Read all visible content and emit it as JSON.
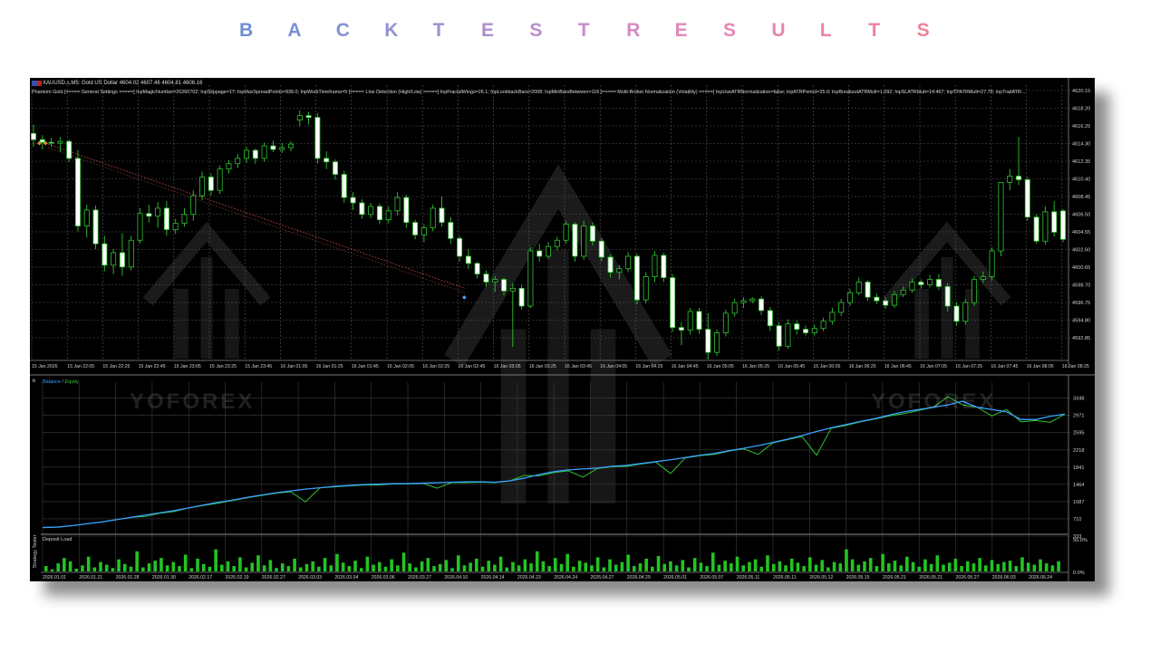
{
  "heading": {
    "letters": [
      "B",
      "A",
      "C",
      "K",
      "T",
      "E",
      "S",
      "T",
      "R",
      "E",
      "S",
      "U",
      "L",
      "T",
      "S"
    ],
    "colors": [
      "#6d8fd4",
      "#7a8fd6",
      "#8390d5",
      "#9191d4",
      "#9e8fd0",
      "#ad8ece",
      "#bb8ccb",
      "#c98bc7",
      "#d58ac2",
      "#dd89bc",
      "#e487b5",
      "#e886ae",
      "#eb85a7",
      "#ec84a0",
      "#ed8399"
    ]
  },
  "terminal": {
    "symbol_line": "XAUUSD.s,M5:  Gold US Dollar  4604.02 4607.46 4604.81 4606.16",
    "params_line": "Phantom Gold [===== General Settings =====] InpMagicNumber=20260702; InpSlippage=17; InpMaxSpreadPoints=936.0; InpWorkTimeframe=5 [===== Line Detection (High/Low) =====] InpFractalWings=26.1; InpLookbackBars=2008; InpMinBarsBetween=116 [===== Multi-Broker Normalization (Volatility) =====] InpUseATRNormalization=false; InpATRPeriod=25.0; InpBreakoutATRMult=1.092; InpSLATRMult=14.467; InpTPATRMult=27.78; InpTrailATR...",
    "price_labels": [
      "4620.15",
      "4618.20",
      "4616.25",
      "4614.30",
      "4612.35",
      "4610.40",
      "4608.45",
      "4606.50",
      "4604.55",
      "4602.60",
      "4600.65",
      "4598.70",
      "4596.75",
      "4594.80",
      "4592.85"
    ],
    "time_labels": [
      "15 Jan 2026",
      "15 Jan 22:05",
      "15 Jan 22:25",
      "15 Jan 22:45",
      "15 Jan 23:05",
      "15 Jan 23:25",
      "15 Jan 23:45",
      "16 Jan 01:05",
      "16 Jan 01:25",
      "16 Jan 01:45",
      "16 Jan 02:05",
      "16 Jan 02:25",
      "16 Jan 02:45",
      "16 Jan 03:05",
      "16 Jan 03:25",
      "16 Jan 03:45",
      "16 Jan 04:05",
      "16 Jan 04:25",
      "16 Jan 04:45",
      "16 Jan 05:05",
      "16 Jan 05:25",
      "16 Jan 05:45",
      "16 Jan 06:05",
      "16 Jan 06:25",
      "16 Jan 06:45",
      "16 Jan 07:05",
      "16 Jan 07:25",
      "16 Jan 07:45",
      "16 Jan 08:05",
      "16 Jan 08:25"
    ],
    "price_range": [
      4591.5,
      4621.0
    ],
    "candles": [
      [
        4617.0,
        4618.0,
        4615.5,
        4616.3
      ],
      [
        4616.3,
        4616.8,
        4615.2,
        4616.0
      ],
      [
        4616.0,
        4616.5,
        4615.5,
        4615.9
      ],
      [
        4615.9,
        4616.6,
        4614.9,
        4616.1
      ],
      [
        4616.1,
        4616.3,
        4613.8,
        4614.2
      ],
      [
        4614.2,
        4615.1,
        4606.0,
        4606.6
      ],
      [
        4606.6,
        4609.0,
        4605.3,
        4608.4
      ],
      [
        4608.4,
        4608.9,
        4604.0,
        4604.6
      ],
      [
        4604.6,
        4605.5,
        4601.5,
        4602.2
      ],
      [
        4602.2,
        4604.0,
        4601.2,
        4603.6
      ],
      [
        4603.6,
        4605.8,
        4601.0,
        4602.0
      ],
      [
        4602.0,
        4605.5,
        4601.6,
        4605.0
      ],
      [
        4605.0,
        4608.6,
        4604.6,
        4608.0
      ],
      [
        4608.0,
        4609.0,
        4607.0,
        4607.7
      ],
      [
        4607.7,
        4609.3,
        4606.4,
        4608.6
      ],
      [
        4608.6,
        4609.4,
        4605.5,
        4606.2
      ],
      [
        4606.2,
        4607.4,
        4605.7,
        4606.9
      ],
      [
        4606.9,
        4608.6,
        4606.5,
        4607.9
      ],
      [
        4607.9,
        4610.6,
        4607.2,
        4610.0
      ],
      [
        4610.0,
        4612.7,
        4609.5,
        4612.1
      ],
      [
        4612.1,
        4612.5,
        4610.0,
        4610.6
      ],
      [
        4610.6,
        4613.4,
        4610.2,
        4613.0
      ],
      [
        4613.0,
        4614.0,
        4612.5,
        4613.6
      ],
      [
        4613.6,
        4614.7,
        4613.1,
        4614.2
      ],
      [
        4614.2,
        4615.5,
        4613.7,
        4615.1
      ],
      [
        4615.1,
        4615.3,
        4613.6,
        4614.2
      ],
      [
        4614.2,
        4616.0,
        4613.8,
        4615.6
      ],
      [
        4615.6,
        4616.2,
        4614.9,
        4615.2
      ],
      [
        4615.2,
        4615.9,
        4614.8,
        4615.4
      ],
      [
        4615.4,
        4616.1,
        4615.0,
        4615.8
      ],
      [
        4618.5,
        4619.6,
        4617.8,
        4619.0
      ],
      [
        4619.0,
        4619.4,
        4618.0,
        4618.8
      ],
      [
        4618.8,
        4619.3,
        4613.6,
        4614.2
      ],
      [
        4614.2,
        4615.0,
        4613.0,
        4613.8
      ],
      [
        4613.8,
        4614.1,
        4611.8,
        4612.4
      ],
      [
        4612.4,
        4612.8,
        4609.2,
        4609.8
      ],
      [
        4609.8,
        4610.4,
        4608.4,
        4609.2
      ],
      [
        4609.2,
        4609.6,
        4607.4,
        4607.9
      ],
      [
        4607.9,
        4609.2,
        4607.5,
        4608.8
      ],
      [
        4608.8,
        4609.1,
        4606.8,
        4607.3
      ],
      [
        4607.3,
        4608.8,
        4606.9,
        4608.3
      ],
      [
        4608.3,
        4610.4,
        4607.8,
        4609.8
      ],
      [
        4609.8,
        4610.1,
        4606.4,
        4607.0
      ],
      [
        4607.0,
        4607.3,
        4605.1,
        4605.6
      ],
      [
        4605.6,
        4606.8,
        4604.8,
        4606.4
      ],
      [
        4606.4,
        4609.0,
        4606.0,
        4608.6
      ],
      [
        4608.6,
        4609.9,
        4606.5,
        4607.0
      ],
      [
        4607.0,
        4607.6,
        4604.6,
        4605.2
      ],
      [
        4605.2,
        4605.5,
        4602.6,
        4603.2
      ],
      [
        4603.2,
        4604.0,
        4601.8,
        4602.4
      ],
      [
        4602.4,
        4602.6,
        4600.7,
        4601.2
      ],
      [
        4601.2,
        4601.6,
        4599.8,
        4600.3
      ],
      [
        4600.3,
        4601.0,
        4599.2,
        4600.6
      ],
      [
        4600.6,
        4600.8,
        4598.8,
        4599.3
      ],
      [
        4599.3,
        4600.2,
        4593.0,
        4599.6
      ],
      [
        4599.6,
        4600.0,
        4597.2,
        4597.6
      ],
      [
        4597.6,
        4604.2,
        4597.4,
        4603.8
      ],
      [
        4603.8,
        4604.6,
        4602.6,
        4603.2
      ],
      [
        4603.2,
        4604.8,
        4602.9,
        4604.3
      ],
      [
        4604.3,
        4605.4,
        4603.9,
        4605.0
      ],
      [
        4605.0,
        4607.2,
        4604.6,
        4606.8
      ],
      [
        4606.8,
        4607.0,
        4602.6,
        4603.2
      ],
      [
        4603.2,
        4607.2,
        4602.8,
        4606.6
      ],
      [
        4606.6,
        4607.0,
        4604.4,
        4604.9
      ],
      [
        4604.9,
        4605.2,
        4602.6,
        4603.1
      ],
      [
        4603.1,
        4603.4,
        4600.8,
        4601.4
      ],
      [
        4601.4,
        4602.2,
        4600.6,
        4601.8
      ],
      [
        4601.8,
        4603.7,
        4601.4,
        4603.2
      ],
      [
        4603.2,
        4603.5,
        4597.8,
        4598.3
      ],
      [
        4598.3,
        4601.4,
        4597.9,
        4600.9
      ],
      [
        4600.9,
        4603.8,
        4600.3,
        4603.3
      ],
      [
        4603.3,
        4603.6,
        4600.3,
        4600.8
      ],
      [
        4600.8,
        4601.2,
        4594.7,
        4595.2
      ],
      [
        4595.2,
        4595.8,
        4593.2,
        4594.9
      ],
      [
        4594.9,
        4597.4,
        4594.4,
        4597.0
      ],
      [
        4597.0,
        4597.4,
        4594.5,
        4595.0
      ],
      [
        4595.0,
        4596.8,
        4591.6,
        4592.4
      ],
      [
        4592.4,
        4595.0,
        4592.0,
        4594.6
      ],
      [
        4594.6,
        4597.2,
        4594.2,
        4596.8
      ],
      [
        4596.8,
        4598.4,
        4596.4,
        4598.0
      ],
      [
        4598.0,
        4598.6,
        4597.4,
        4598.2
      ],
      [
        4598.2,
        4598.6,
        4597.9,
        4598.4
      ],
      [
        4598.4,
        4598.7,
        4596.6,
        4597.1
      ],
      [
        4597.1,
        4597.5,
        4594.8,
        4595.4
      ],
      [
        4595.4,
        4595.8,
        4592.6,
        4593.1
      ],
      [
        4593.1,
        4596.1,
        4592.8,
        4595.6
      ],
      [
        4595.6,
        4596.0,
        4594.4,
        4595.0
      ],
      [
        4595.0,
        4595.4,
        4594.3,
        4594.6
      ],
      [
        4594.6,
        4595.5,
        4594.3,
        4595.1
      ],
      [
        4595.1,
        4596.3,
        4594.8,
        4595.9
      ],
      [
        4595.9,
        4597.4,
        4595.5,
        4596.9
      ],
      [
        4596.9,
        4598.4,
        4596.5,
        4598.0
      ],
      [
        4598.0,
        4599.5,
        4597.6,
        4599.1
      ],
      [
        4599.1,
        4600.8,
        4598.8,
        4600.3
      ],
      [
        4600.3,
        4600.5,
        4598.2,
        4598.6
      ],
      [
        4598.6,
        4599.0,
        4597.8,
        4598.2
      ],
      [
        4598.2,
        4598.6,
        4597.3,
        4597.7
      ],
      [
        4597.7,
        4599.3,
        4597.4,
        4598.9
      ],
      [
        4598.9,
        4599.8,
        4598.6,
        4599.4
      ],
      [
        4599.4,
        4600.7,
        4599.1,
        4600.3
      ],
      [
        4600.3,
        4600.6,
        4599.6,
        4600.0
      ],
      [
        4600.0,
        4601.1,
        4599.7,
        4600.6
      ],
      [
        4600.6,
        4601.2,
        4599.4,
        4599.8
      ],
      [
        4599.8,
        4600.2,
        4597.0,
        4597.6
      ],
      [
        4597.6,
        4598.0,
        4595.4,
        4595.9
      ],
      [
        4595.9,
        4598.4,
        4595.5,
        4598.0
      ],
      [
        4598.0,
        4601.0,
        4597.6,
        4600.6
      ],
      [
        4600.6,
        4601.5,
        4600.2,
        4600.9
      ],
      [
        4600.9,
        4604.2,
        4600.5,
        4603.8
      ],
      [
        4603.8,
        4610.8,
        4603.2,
        4611.5
      ],
      [
        4611.5,
        4613.0,
        4610.6,
        4612.2
      ],
      [
        4612.2,
        4616.6,
        4611.2,
        4611.8
      ],
      [
        4611.8,
        4612.1,
        4607.2,
        4607.6
      ],
      [
        4607.6,
        4607.9,
        4604.6,
        4604.9
      ],
      [
        4604.9,
        4608.8,
        4604.5,
        4608.2
      ],
      [
        4608.2,
        4609.4,
        4605.4,
        4605.9
      ],
      [
        4608.3,
        4608.5,
        4604.8,
        4605.1
      ]
    ],
    "trendline_note": "",
    "equity": {
      "title_balance": "Balance",
      "title_equity": "Equity",
      "y_labels": [
        "3348",
        "2971",
        "2595",
        "2218",
        "1841",
        "1464",
        "1087",
        "710",
        "333"
      ],
      "x_labels": [
        "2026.01.01",
        "2026.01.21",
        "2026.01.28",
        "2026.01.30",
        "2026.02.17",
        "2026.02.19",
        "2026.02.27",
        "2026.03.03",
        "2026.03.04",
        "2026.03.06",
        "2026.03.27",
        "2026.04.10",
        "2026.04.14",
        "2026.04.23",
        "2026.04.24",
        "2026.04.27",
        "2026.04.29",
        "2026.05.01",
        "2026.05.07",
        "2026.05.11",
        "2026.05.11",
        "2026.05.12",
        "2026.05.15",
        "2026.05.21",
        "2026.05.21",
        "2026.05.27",
        "2026.06.03",
        "2026.06.24"
      ],
      "y_range": [
        333,
        3500
      ],
      "balance": [
        520,
        530,
        560,
        600,
        640,
        690,
        740,
        790,
        840,
        890,
        950,
        1010,
        1070,
        1120,
        1180,
        1230,
        1280,
        1320,
        1360,
        1390,
        1420,
        1440,
        1460,
        1470,
        1480,
        1480,
        1490,
        1500,
        1510,
        1520,
        1520,
        1510,
        1540,
        1600,
        1680,
        1740,
        1780,
        1800,
        1820,
        1860,
        1880,
        1920,
        1960,
        2000,
        2050,
        2100,
        2140,
        2200,
        2250,
        2310,
        2380,
        2450,
        2530,
        2620,
        2700,
        2770,
        2840,
        2900,
        2980,
        3050,
        3100,
        3150,
        3200,
        3280,
        3150,
        3100,
        3050,
        2880,
        2880,
        2950,
        3000
      ],
      "equity": [
        520,
        530,
        560,
        600,
        640,
        690,
        740,
        760,
        830,
        870,
        950,
        1000,
        1050,
        1110,
        1170,
        1220,
        1270,
        1300,
        1080,
        1390,
        1410,
        1430,
        1450,
        1450,
        1470,
        1470,
        1490,
        1380,
        1500,
        1500,
        1510,
        1500,
        1540,
        1660,
        1650,
        1720,
        1760,
        1620,
        1810,
        1850,
        1860,
        1910,
        1950,
        1700,
        2040,
        2090,
        2120,
        2190,
        2240,
        2120,
        2370,
        2440,
        2510,
        2100,
        2690,
        2750,
        2830,
        2890,
        2960,
        3010,
        3080,
        3150,
        3380,
        3200,
        3150,
        2960,
        3100,
        2830,
        2860,
        2820,
        3000
      ]
    },
    "deposit": {
      "title": "Deposit Load",
      "y_labels": [
        "50.0%",
        "0.0%"
      ],
      "bars": [
        8,
        3,
        12,
        20,
        15,
        4,
        9,
        22,
        6,
        14,
        10,
        5,
        18,
        11,
        7,
        30,
        6,
        12,
        16,
        20,
        9,
        14,
        8,
        25,
        5,
        19,
        11,
        7,
        33,
        10,
        15,
        8,
        21,
        6,
        13,
        24,
        9,
        17,
        5,
        12,
        8,
        19,
        6,
        11,
        15,
        7,
        20,
        9,
        26,
        13,
        8,
        16,
        5,
        22,
        10,
        14,
        7,
        18,
        9,
        28,
        12,
        6,
        15,
        20,
        8,
        11,
        17,
        5,
        24,
        9,
        13,
        19,
        7,
        16,
        10,
        22,
        6,
        14,
        9,
        18,
        12,
        30,
        15,
        8,
        20,
        11,
        26,
        7,
        16,
        13,
        9,
        21,
        6,
        18,
        10,
        14,
        25,
        8,
        12,
        19,
        7,
        23,
        11,
        15,
        9,
        17,
        6,
        20,
        13,
        8,
        28,
        10,
        16,
        12,
        22,
        9,
        14,
        18,
        7,
        24,
        11,
        15,
        9,
        19,
        13,
        8,
        21,
        10,
        17,
        6,
        14,
        12,
        33,
        18,
        10,
        15,
        20,
        8,
        26,
        12,
        16,
        9,
        22,
        14,
        7,
        18,
        11,
        24,
        10,
        13,
        19,
        8,
        15,
        12,
        20,
        9,
        17,
        11,
        14,
        16,
        8,
        21,
        13,
        10,
        18,
        12,
        9,
        15
      ]
    },
    "side_tab": "Strategy Tester"
  },
  "watermark": {
    "brand": "YOFOREX"
  }
}
